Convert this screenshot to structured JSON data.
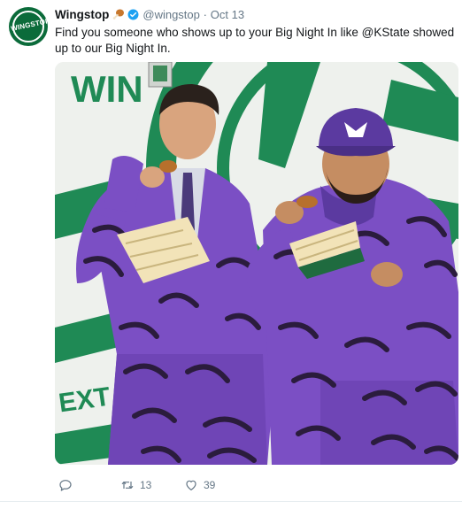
{
  "tweet": {
    "author_name": "Wingstop",
    "avatar_text": "WINGSTOP",
    "handle": "@wingstop",
    "separator": "·",
    "date": "Oct 13",
    "text": "Find you someone who shows up to your Big Night In like @KState showed up to our Big Night In.",
    "photo_sign_text": "WIN",
    "photo_sign_text_bottom": "EXT",
    "actions": {
      "reply_count": "",
      "retweet_count": "13",
      "like_count": "39"
    },
    "icons": [
      "drumstick-emoji",
      "verified-badge-icon",
      "reply-icon",
      "retweet-icon",
      "like-icon"
    ],
    "colors": {
      "brand_green": "#0b6b3a",
      "verified_blue": "#1da1f2",
      "meta_gray": "#657786",
      "suit_purple": "#7b4fc4"
    }
  }
}
